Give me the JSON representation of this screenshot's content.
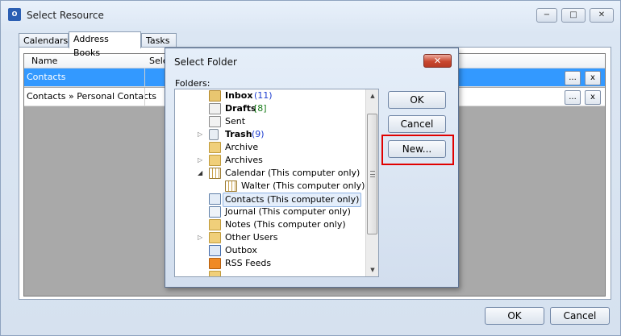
{
  "window": {
    "title": "Select Resource",
    "app_icon_text": "O",
    "minimize": "−",
    "maximize": "□",
    "close": "✕"
  },
  "tabs": [
    "Calendars",
    "Address Books",
    "Tasks"
  ],
  "grid": {
    "col_name": "Name",
    "col_select": "Sele",
    "rows": [
      {
        "name": "Contacts",
        "browse": "...",
        "remove": "x"
      },
      {
        "name": "Contacts » Personal Contacts",
        "browse": "...",
        "remove": "x"
      }
    ]
  },
  "footer": {
    "ok": "OK",
    "cancel": "Cancel"
  },
  "dialog": {
    "title": "Select Folder",
    "close": "✕",
    "folders_label": "Folders:",
    "ok": "OK",
    "cancel": "Cancel",
    "new": "New...",
    "items": [
      {
        "label": "Inbox",
        "count": "(11)"
      },
      {
        "label": "Drafts",
        "count": "[8]"
      },
      {
        "label": "Sent"
      },
      {
        "label": "Trash",
        "count": "(9)"
      },
      {
        "label": "Archive"
      },
      {
        "label": "Archives"
      },
      {
        "label": "Calendar (This computer only)"
      },
      {
        "label": "Walter (This computer only)"
      },
      {
        "label": "Contacts (This computer only)"
      },
      {
        "label": "Journal (This computer only)"
      },
      {
        "label": "Notes (This computer only)"
      },
      {
        "label": "Other Users"
      },
      {
        "label": "Outbox"
      },
      {
        "label": "RSS Feeds"
      }
    ]
  }
}
